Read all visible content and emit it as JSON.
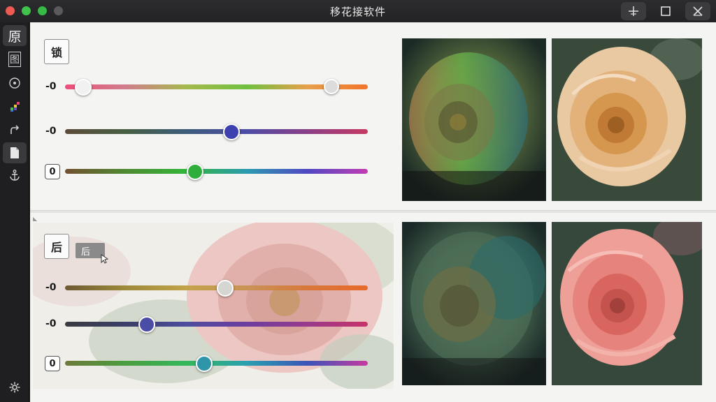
{
  "window": {
    "title": "移花接软件",
    "pin_icon": "pin-icon",
    "maximize_icon": "maximize-icon",
    "close_icon": "close-icon"
  },
  "sidebar": {
    "items": [
      {
        "label": "原",
        "icon": "original-icon",
        "active": true
      },
      {
        "label": "图",
        "icon": "image-icon"
      },
      {
        "icon": "compass-icon"
      },
      {
        "icon": "palette-icon"
      },
      {
        "icon": "share-icon"
      },
      {
        "icon": "document-icon",
        "active": true
      },
      {
        "icon": "anchor-icon"
      }
    ],
    "settings_icon": "gear-icon"
  },
  "top_panel": {
    "lock_label": "锁",
    "sliders": [
      {
        "label": "-0",
        "value": 0.06,
        "second_value": 0.88,
        "colors": [
          "#ec4f7a",
          "#d07d8c",
          "#a6b94c",
          "#6fc040",
          "#e7a04c",
          "#f2742a"
        ]
      },
      {
        "label": "-0",
        "value": 0.55,
        "colors": [
          "#5d4a3a",
          "#476044",
          "#3d5c7a",
          "#4e4ca6",
          "#8a3f88",
          "#c63a62"
        ],
        "thumb_color": "#3e40b0"
      },
      {
        "label": "0",
        "value": 0.43,
        "colors": [
          "#735030",
          "#4e8a32",
          "#33b63b",
          "#2c9bb0",
          "#5048c2",
          "#c23cb4"
        ],
        "thumb_color": "#2fae3c"
      }
    ]
  },
  "bottom_panel": {
    "after_label": "后",
    "tag_label": "后",
    "sliders": [
      {
        "label": "-0",
        "value": 0.53,
        "colors": [
          "#6d5a32",
          "#9d8a3a",
          "#c2a34a",
          "#c99357",
          "#d7783a",
          "#e86a2c"
        ],
        "thumb_color": "#d5d5d2"
      },
      {
        "label": "-0",
        "value": 0.27,
        "colors": [
          "#3a3a40",
          "#3b3e68",
          "#4c4c9e",
          "#6c3ea0",
          "#983a8c",
          "#c8326a"
        ],
        "thumb_color": "#4b4ca5"
      },
      {
        "label": "0",
        "value": 0.46,
        "colors": [
          "#6c7a3a",
          "#4b9e3e",
          "#34b85c",
          "#2aa0b0",
          "#3a54b8",
          "#c83aa0"
        ],
        "thumb_color": "#2f95a8"
      }
    ]
  },
  "colors": {
    "accent": "#3e40b0",
    "sidebar_bg": "#1f1f21",
    "panel_bg": "#f4f4f3"
  }
}
